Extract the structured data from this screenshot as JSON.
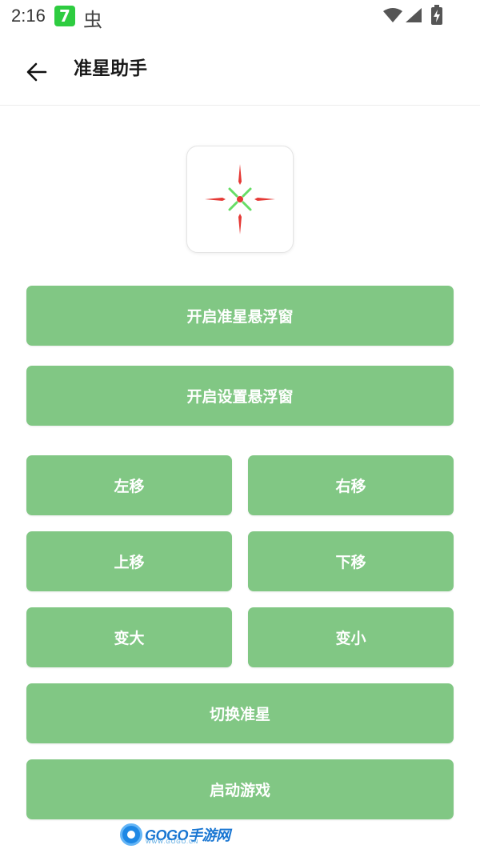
{
  "status_bar": {
    "time": "2:16",
    "app_badge": "7",
    "bug_glyph": "虫",
    "icons": [
      "wifi-icon",
      "signal-icon",
      "battery-charging-icon"
    ]
  },
  "toolbar": {
    "back_icon": "arrow-left-icon",
    "title": "准星助手"
  },
  "crosshair_preview": {
    "icon": "crosshair-icon",
    "colors": {
      "outer": "#e53935",
      "inner": "#66dd66",
      "center": "#e53935"
    }
  },
  "buttons": {
    "open_crosshair_float": "开启准星悬浮窗",
    "open_settings_float": "开启设置悬浮窗",
    "move_left": "左移",
    "move_right": "右移",
    "move_up": "上移",
    "move_down": "下移",
    "enlarge": "变大",
    "shrink": "变小",
    "switch_crosshair": "切换准星",
    "start_game": "启动游戏"
  },
  "theme": {
    "button_bg": "#81c784",
    "button_text": "#ffffff"
  },
  "watermark": {
    "brand": "GOGO手游网",
    "url": "WWW.GOGO.CN"
  }
}
